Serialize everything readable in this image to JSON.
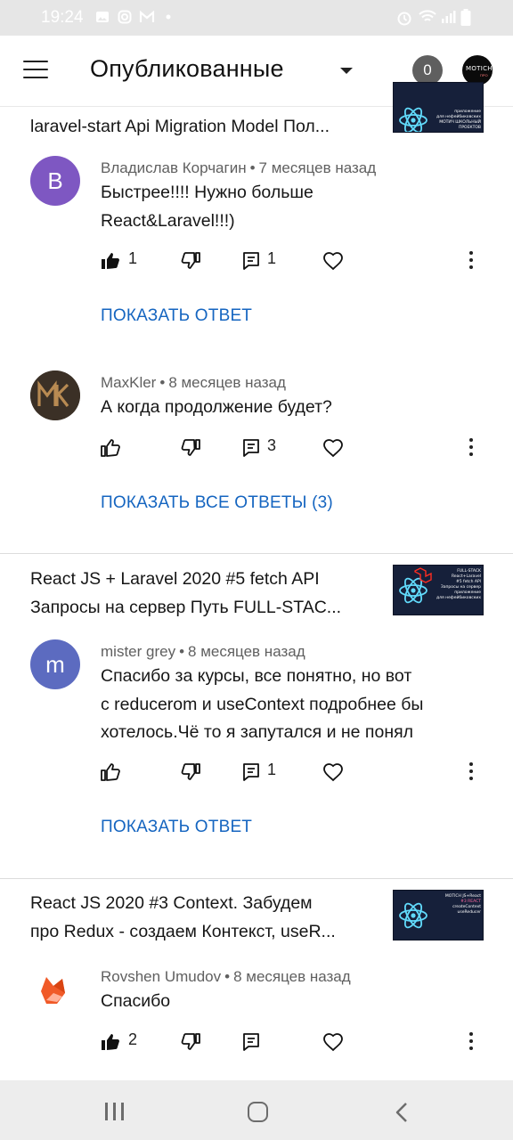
{
  "status_bar": {
    "time": "19:24"
  },
  "header": {
    "title": "Опубликованные",
    "badge_count": "0",
    "channel_logo_text": "MOTICH",
    "channel_logo_sub": "ПРО"
  },
  "videos": [
    {
      "title_lines": [
        "laravel-start Api Migration Model Пол..."
      ],
      "thumb_lines": [
        "приложение",
        "для нефейбиковских",
        "МОТИЧ ШКОЛЬНЫЙ ПРОЕКТОВ"
      ]
    },
    {
      "title_lines": [
        "React JS + Laravel 2020 #5 fetch API",
        "Запросы на сервер Путь FULL-STAC..."
      ],
      "thumb_lines": [
        "FULL-STACK",
        "React+Laravel",
        "#5 fetch API",
        "Запросы на сервер",
        "приложение",
        "для нефейбиковских"
      ]
    },
    {
      "title_lines": [
        "React JS 2020 #3 Context. Забудем",
        "про Redux - создаем Контекст, useR..."
      ],
      "thumb_lines": [
        "MOTICH JS+React",
        "#3 REACT",
        "createContext",
        "useReducer"
      ]
    }
  ],
  "comments": [
    {
      "author": "Владислав Корчагин",
      "time": "7 месяцев назад",
      "avatar_letter": "B",
      "avatar_color": "#7e57c2",
      "text_lines": [
        "Быстрее!!!! Нужно больше",
        "React&Laravel!!!)"
      ],
      "likes": "1",
      "replies_count": "1",
      "liked": true,
      "show_replies": "ПОКАЗАТЬ ОТВЕТ"
    },
    {
      "author": "MaxKler",
      "time": "8 месяцев назад",
      "avatar_letter": "MK",
      "avatar_color": "#3b3026",
      "text_lines": [
        "А когда продолжение будет?"
      ],
      "likes": "",
      "replies_count": "3",
      "liked": false,
      "show_replies": "ПОКАЗАТЬ ВСЕ ОТВЕТЫ (3)"
    },
    {
      "author": "mister grey",
      "time": "8 месяцев назад",
      "avatar_letter": "m",
      "avatar_color": "#5c6bc0",
      "text_lines": [
        "Спасибо за курсы, все понятно, но вот",
        "с reducerom и  useContext подробнее бы",
        "хотелось.Чё то я запутался и не понял"
      ],
      "likes": "",
      "replies_count": "1",
      "liked": false,
      "show_replies": "ПОКАЗАТЬ ОТВЕТ"
    },
    {
      "author": "Rovshen Umudov",
      "time": "8 месяцев назад",
      "avatar_letter": "",
      "avatar_color": "#ffffff",
      "text_lines": [
        "Спасибо"
      ],
      "likes": "2",
      "replies_count": "",
      "liked": true,
      "show_replies": ""
    }
  ],
  "colors": {
    "link": "#1565c0",
    "meta": "#606060",
    "status_bar": "#e6e6e6",
    "nav_bar": "#ededed"
  },
  "icons": [
    "menu-icon",
    "dropdown-icon",
    "thumb-up-icon",
    "thumb-down-icon",
    "reply-icon",
    "heart-icon",
    "more-vert-icon"
  ]
}
